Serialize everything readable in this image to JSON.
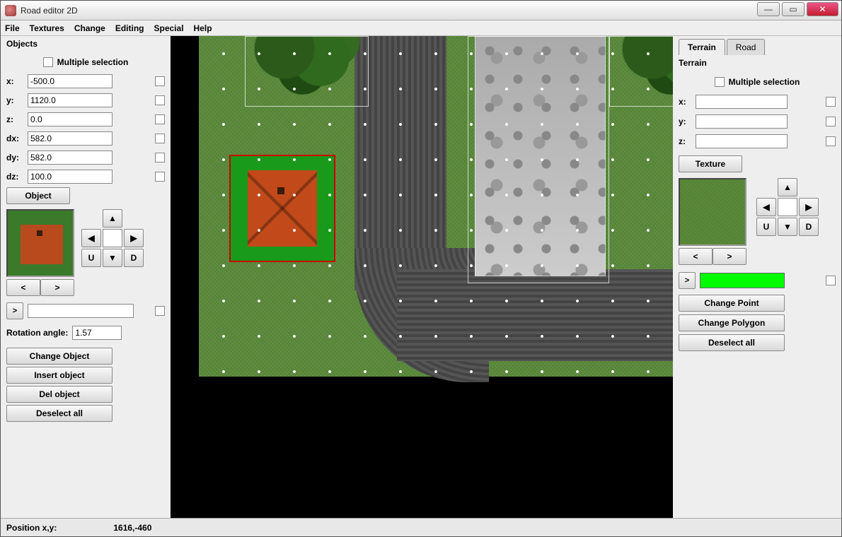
{
  "window": {
    "title": "Road editor 2D"
  },
  "menu": {
    "file": "File",
    "textures": "Textures",
    "change": "Change",
    "editing": "Editing",
    "special": "Special",
    "help": "Help"
  },
  "left": {
    "title": "Objects",
    "multiple_selection": "Multiple selection",
    "x_label": "x:",
    "x": "-500.0",
    "y_label": "y:",
    "y": "1120.0",
    "z_label": "z:",
    "z": "0.0",
    "dx_label": "dx:",
    "dx": "582.0",
    "dy_label": "dy:",
    "dy": "582.0",
    "dz_label": "dz:",
    "dz": "100.0",
    "object_btn": "Object",
    "prev": "<",
    "next": ">",
    "expand": ">",
    "rotation_label": "Rotation angle:",
    "rotation": "1.57",
    "change_object": "Change Object",
    "insert_object": "Insert object",
    "del_object": "Del object",
    "deselect_all": "Deselect all",
    "nav": {
      "up": "▲",
      "left": "◀",
      "right": "▶",
      "down": "▼",
      "u": "U",
      "d": "D",
      "center": ""
    }
  },
  "right": {
    "tab_terrain": "Terrain",
    "tab_road": "Road",
    "title": "Terrain",
    "multiple_selection": "Multiple selection",
    "x_label": "x:",
    "x": "",
    "y_label": "y:",
    "y": "",
    "z_label": "z:",
    "z": "",
    "texture_btn": "Texture",
    "prev": "<",
    "next": ">",
    "expand": ">",
    "change_point": "Change Point",
    "change_polygon": "Change Polygon",
    "deselect_all": "Deselect all",
    "nav": {
      "up": "▲",
      "left": "◀",
      "right": "▶",
      "down": "▼",
      "u": "U",
      "d": "D",
      "center": ""
    },
    "color": "#00ff00"
  },
  "status": {
    "label": "Position x,y:",
    "value": "1616,-460"
  }
}
